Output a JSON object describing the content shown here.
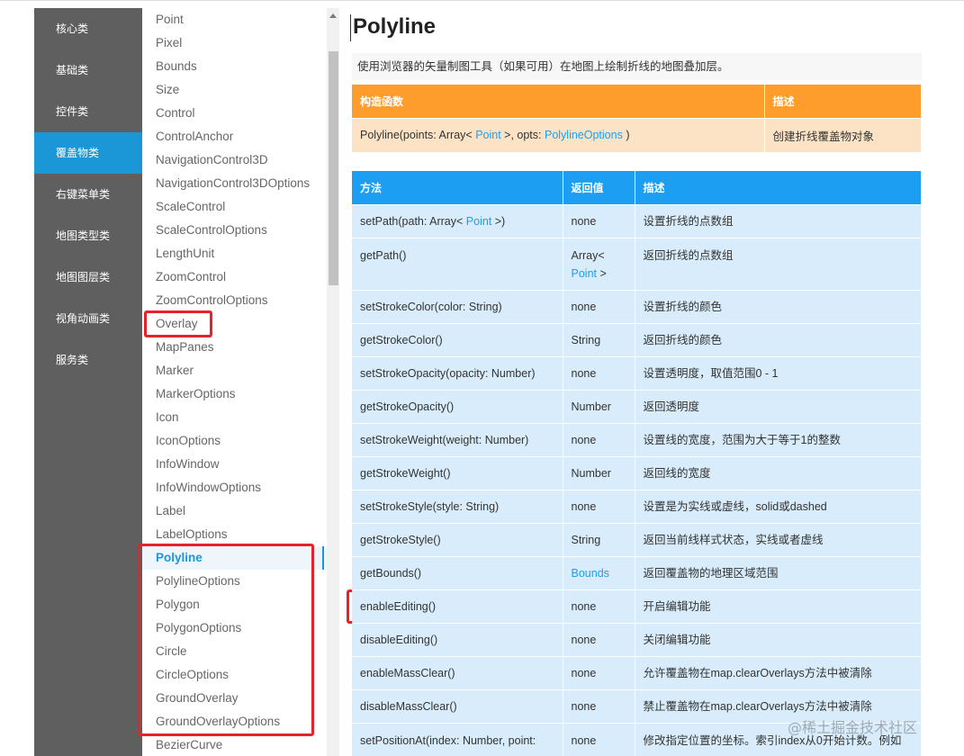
{
  "categories": [
    "核心类",
    "基础类",
    "控件类",
    "覆盖物类",
    "右键菜单类",
    "地图类型类",
    "地图图层类",
    "视角动画类",
    "服务类"
  ],
  "active_category": "覆盖物类",
  "classes": [
    "Point",
    "Pixel",
    "Bounds",
    "Size",
    "Control",
    "ControlAnchor",
    "NavigationControl3D",
    "NavigationControl3DOptions",
    "ScaleControl",
    "ScaleControlOptions",
    "LengthUnit",
    "ZoomControl",
    "ZoomControlOptions",
    "Overlay",
    "MapPanes",
    "Marker",
    "MarkerOptions",
    "Icon",
    "IconOptions",
    "InfoWindow",
    "InfoWindowOptions",
    "Label",
    "LabelOptions",
    "Polyline",
    "PolylineOptions",
    "Polygon",
    "PolygonOptions",
    "Circle",
    "CircleOptions",
    "GroundOverlay",
    "GroundOverlayOptions",
    "BezierCurve"
  ],
  "active_class": "Polyline",
  "page": {
    "title": "Polyline",
    "description": "使用浏览器的矢量制图工具（如果可用）在地图上绘制折线的地图叠加层。"
  },
  "constructor_table": {
    "headers": [
      "构造函数",
      "描述"
    ],
    "signature_prefix": "Polyline(points: Array< ",
    "signature_link1": "Point",
    "signature_mid": " >, opts: ",
    "signature_link2": "PolylineOptions",
    "signature_suffix": " )",
    "description": "创建折线覆盖物对象"
  },
  "methods_table": {
    "headers": [
      "方法",
      "返回值",
      "描述"
    ],
    "rows": [
      {
        "method": "setPath(path: Array< ",
        "method_link": "Point",
        "method_suffix": " >)",
        "return": "none",
        "desc": "设置折线的点数组"
      },
      {
        "method": "getPath()",
        "return": "Array<",
        "return_link": "Point",
        "return_suffix": " >",
        "desc": "返回折线的点数组"
      },
      {
        "method": "setStrokeColor(color: String)",
        "return": "none",
        "desc": "设置折线的颜色"
      },
      {
        "method": "getStrokeColor()",
        "return": "String",
        "desc": "返回折线的颜色"
      },
      {
        "method": "setStrokeOpacity(opacity: Number)",
        "return": "none",
        "desc": "设置透明度，取值范围0 - 1"
      },
      {
        "method": "getStrokeOpacity()",
        "return": "Number",
        "desc": "返回透明度"
      },
      {
        "method": "setStrokeWeight(weight: Number)",
        "return": "none",
        "desc": "设置线的宽度，范围为大于等于1的整数"
      },
      {
        "method": "getStrokeWeight()",
        "return": "Number",
        "desc": "返回线的宽度"
      },
      {
        "method": "setStrokeStyle(style: String)",
        "return": "none",
        "desc": "设置是为实线或虚线，solid或dashed"
      },
      {
        "method": "getStrokeStyle()",
        "return": "String",
        "desc": "返回当前线样式状态，实线或者虚线"
      },
      {
        "method": "getBounds()",
        "return_link_only": "Bounds",
        "desc": "返回覆盖物的地理区域范围"
      },
      {
        "method": "enableEditing()",
        "return": "none",
        "desc": "开启编辑功能"
      },
      {
        "method": "disableEditing()",
        "return": "none",
        "desc": "关闭编辑功能"
      },
      {
        "method": "enableMassClear()",
        "return": "none",
        "desc": "允许覆盖物在map.clearOverlays方法中被清除"
      },
      {
        "method": "disableMassClear()",
        "return": "none",
        "desc": "禁止覆盖物在map.clearOverlays方法中被清除"
      },
      {
        "method": "setPositionAt(index: Number, point:",
        "return": "none",
        "desc": "修改指定位置的坐标。索引index从0开始计数。例如"
      }
    ]
  },
  "watermark": "@稀土掘金技术社区"
}
